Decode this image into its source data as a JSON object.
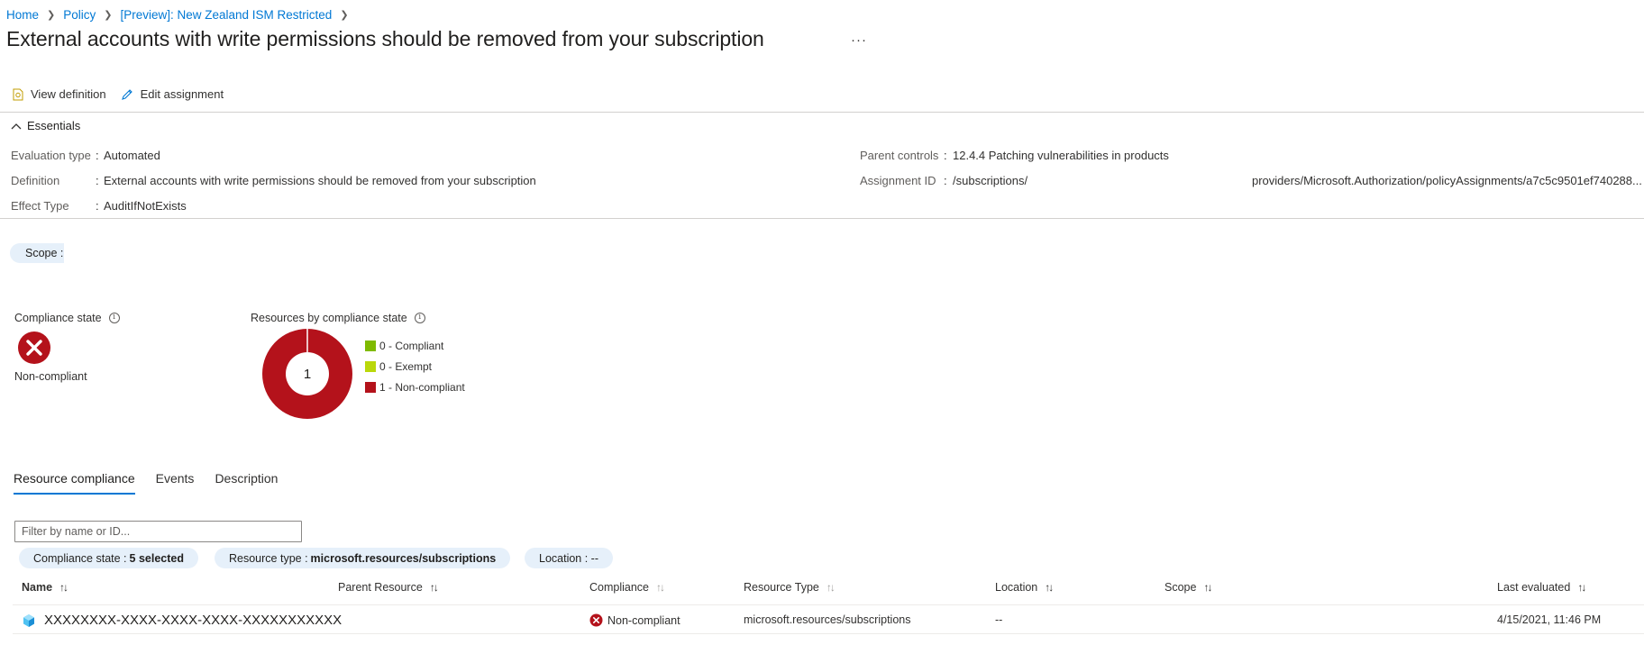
{
  "breadcrumb": {
    "items": [
      "Home",
      "Policy",
      "[Preview]: New Zealand ISM Restricted"
    ]
  },
  "title": "External accounts with write permissions should be removed from your subscription",
  "more_label": "···",
  "toolbar": {
    "view_definition": "View definition",
    "edit_assignment": "Edit assignment"
  },
  "essentials": {
    "toggle_label": "Essentials",
    "left": [
      {
        "label": "Evaluation type",
        "value": "Automated"
      },
      {
        "label": "Definition",
        "value": "External accounts with write permissions should be removed from your subscription"
      },
      {
        "label": "Effect Type",
        "value": "AuditIfNotExists"
      }
    ],
    "right": [
      {
        "label": "Parent controls",
        "value": "12.4.4 Patching vulnerabilities in products"
      },
      {
        "label": "Assignment ID",
        "value": "/subscriptions/",
        "value2": "providers/Microsoft.Authorization/policyAssignments/a7c5c9501ef740288..."
      }
    ],
    "colon": ":"
  },
  "scope": {
    "label": "Scope :"
  },
  "compliance_state": {
    "label": "Compliance state",
    "value": "Non-compliant"
  },
  "resources_by_state": {
    "label": "Resources by compliance state",
    "center_value": "1",
    "legend": [
      {
        "label": "0 - Compliant",
        "color": "#7fba00"
      },
      {
        "label": "0 - Exempt",
        "color": "#bad80a"
      },
      {
        "label": "1 - Non-compliant",
        "color": "#b4121b"
      }
    ]
  },
  "chart_data": {
    "type": "pie",
    "categories": [
      "Compliant",
      "Exempt",
      "Non-compliant"
    ],
    "values": [
      0,
      0,
      1
    ]
  },
  "tabs": [
    "Resource compliance",
    "Events",
    "Description"
  ],
  "filter": {
    "placeholder": "Filter by name or ID..."
  },
  "filter_pills": [
    {
      "label": "Compliance state :",
      "value": "5 selected"
    },
    {
      "label": "Resource type :",
      "value": "microsoft.resources/subscriptions"
    },
    {
      "label": "Location : --",
      "value": ""
    }
  ],
  "table": {
    "headers": [
      "Name",
      "Parent Resource",
      "Compliance",
      "Resource Type",
      "Location",
      "Scope",
      "Last evaluated"
    ],
    "sort_icon": "↑↓",
    "rows": [
      {
        "name": "XXXXXXXX-XXXX-XXXX-XXXX-XXXXXXXXXXX",
        "parent": "",
        "compliance": "Non-compliant",
        "resource_type": "microsoft.resources/subscriptions",
        "location": "--",
        "scope": "",
        "last_evaluated": "4/15/2021, 11:46 PM"
      }
    ]
  },
  "colors": {
    "link": "#0078d4",
    "error": "#b4121b",
    "pill_bg": "#e6f0fa"
  }
}
